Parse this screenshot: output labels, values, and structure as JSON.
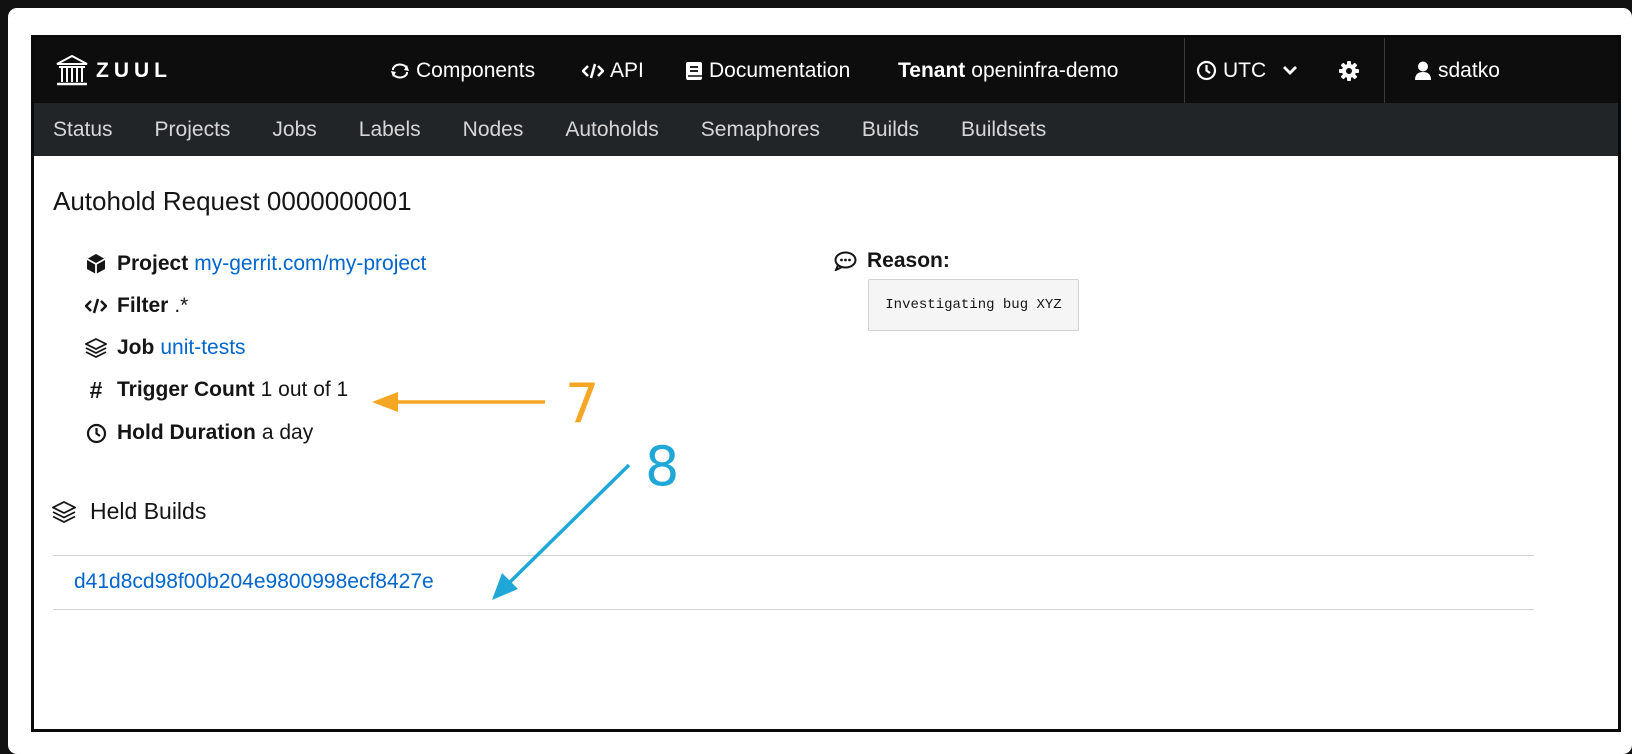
{
  "header": {
    "logo_text": "ZUUL",
    "nav": [
      {
        "label": "Components",
        "icon": "components-icon"
      },
      {
        "label": "API",
        "icon": "code-icon"
      },
      {
        "label": "Documentation",
        "icon": "book-icon"
      }
    ],
    "tenant": {
      "label": "Tenant",
      "value": "openinfra-demo"
    },
    "timezone": "UTC",
    "user": "sdatko"
  },
  "subnav": [
    "Status",
    "Projects",
    "Jobs",
    "Labels",
    "Nodes",
    "Autoholds",
    "Semaphores",
    "Builds",
    "Buildsets"
  ],
  "autohold": {
    "title": "Autohold Request 0000000001",
    "project": {
      "label": "Project",
      "value": "my-gerrit.com/my-project"
    },
    "filter": {
      "label": "Filter",
      "value": ".*"
    },
    "job": {
      "label": "Job",
      "value": "unit-tests"
    },
    "trigger": {
      "label": "Trigger Count",
      "value": "1 out of 1"
    },
    "duration": {
      "label": "Hold Duration",
      "value": "a day"
    },
    "reason": {
      "label": "Reason:",
      "value": "Investigating bug XYZ"
    }
  },
  "held_builds": {
    "title": "Held Builds",
    "builds": [
      "d41d8cd98f00b204e9800998ecf8427e"
    ]
  },
  "annotations": [
    {
      "label": "7",
      "color": "#f5a623"
    },
    {
      "label": "8",
      "color": "#1fa7d8"
    }
  ]
}
